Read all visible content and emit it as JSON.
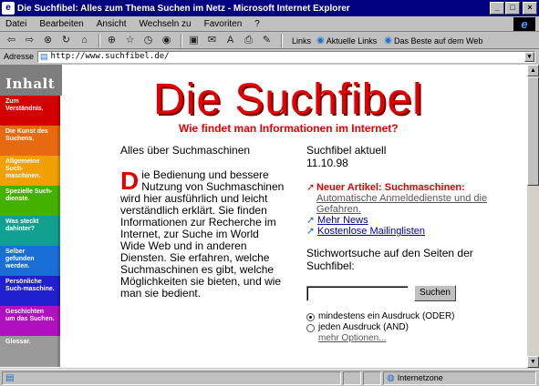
{
  "window": {
    "title": "Die Suchfibel: Alles zum Thema Suchen im Netz - Microsoft Internet Explorer",
    "app_icon": "e",
    "minimize": "_",
    "maximize": "□",
    "close": "×"
  },
  "menu": [
    "Datei",
    "Bearbeiten",
    "Ansicht",
    "Wechseln zu",
    "Favoriten",
    "?"
  ],
  "ie_logo": "e",
  "toolbar": {
    "links_label": "Links",
    "links": [
      "Aktuelle Links",
      "Das Beste auf dem Web"
    ]
  },
  "address": {
    "label": "Adresse",
    "url": "http://www.suchfibel.de/"
  },
  "sidebar": {
    "heading": "Inhalt",
    "items": [
      {
        "label": "Zum Verständnis.",
        "color": "#d40000"
      },
      {
        "label": "Die Kunst des Suchens.",
        "color": "#e86a10"
      },
      {
        "label": "Allgemeine Such-maschinen.",
        "color": "#f0a000"
      },
      {
        "label": "Spezielle Such-dienste.",
        "color": "#44b000"
      },
      {
        "label": "Was steckt dahinter?",
        "color": "#10a090"
      },
      {
        "label": "Selber gefunden werden.",
        "color": "#1a6fd6"
      },
      {
        "label": "Persönliche Such-maschine.",
        "color": "#2020d0"
      },
      {
        "label": "Geschichten um das Suchen.",
        "color": "#b010c0"
      },
      {
        "label": "Glossar.",
        "color": "#9a9a9a"
      }
    ]
  },
  "main": {
    "title": "Die Suchfibel",
    "subtitle": "Wie findet man Informationen im Internet?",
    "left_heading": "Alles über Suchmaschinen",
    "dropcap": "D",
    "body": "ie Bedienung und bessere Nutzung von Suchmaschinen wird hier ausführlich und leicht verständlich erklärt. Sie finden Informationen zur Recherche im Internet, zur Suche im World Wide Web und in anderen Diensten. Sie erfahren, welche Suchmaschinen es gibt, welche Möglichkeiten sie bieten, und wie man sie bedient.",
    "right_heading": "Suchfibel aktuell",
    "date": "11.10.98",
    "news": {
      "item1_label": "Neuer Artikel: Suchmaschinen:",
      "item1_link": "Automatische Anmeldedienste und die Gefahren.",
      "item2": "Mehr News",
      "item3": "Kostenlose Mailinglisten"
    },
    "search_title": "Stichwortsuche auf den Seiten der Suchfibel:",
    "search_value": "",
    "search_button": "Suchen",
    "option1": "mindestens ein Ausdruck (ODER)",
    "option2": "jeden Ausdruck (AND)",
    "more": "mehr Optionen..."
  },
  "status": {
    "zone": "Internetzone"
  }
}
